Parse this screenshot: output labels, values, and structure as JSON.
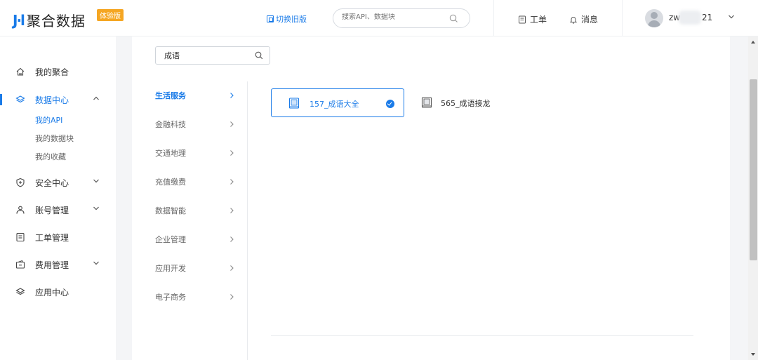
{
  "header": {
    "logo_mark": "J·l",
    "logo_text": "聚合数据",
    "badge": "体验版",
    "switch_old": "切换旧版",
    "search_placeholder": "搜索API、数据块",
    "workorder": "工单",
    "messages": "消息",
    "user_prefix": "zw",
    "user_suffix": "21"
  },
  "sidebar": {
    "items": [
      {
        "label": "我的聚合",
        "icon": "home-icon"
      },
      {
        "label": "数据中心",
        "icon": "layers-icon",
        "active": true
      },
      {
        "label": "安全中心",
        "icon": "shield-icon"
      },
      {
        "label": "账号管理",
        "icon": "user-icon"
      },
      {
        "label": "工单管理",
        "icon": "document-icon"
      },
      {
        "label": "费用管理",
        "icon": "wallet-icon"
      },
      {
        "label": "应用中心",
        "icon": "layers-icon"
      }
    ],
    "sub_items": [
      "我的API",
      "我的数据块",
      "我的收藏"
    ]
  },
  "main": {
    "search_value": "成语",
    "categories": [
      "生活服务",
      "金融科技",
      "交通地理",
      "充值缴费",
      "数据智能",
      "企业管理",
      "应用开发",
      "电子商务"
    ],
    "apis": [
      {
        "label": "157_成语大全",
        "selected": true
      },
      {
        "label": "565_成语接龙",
        "selected": false
      }
    ]
  },
  "colors": {
    "accent": "#1a7be8",
    "badge": "#f5a623"
  }
}
